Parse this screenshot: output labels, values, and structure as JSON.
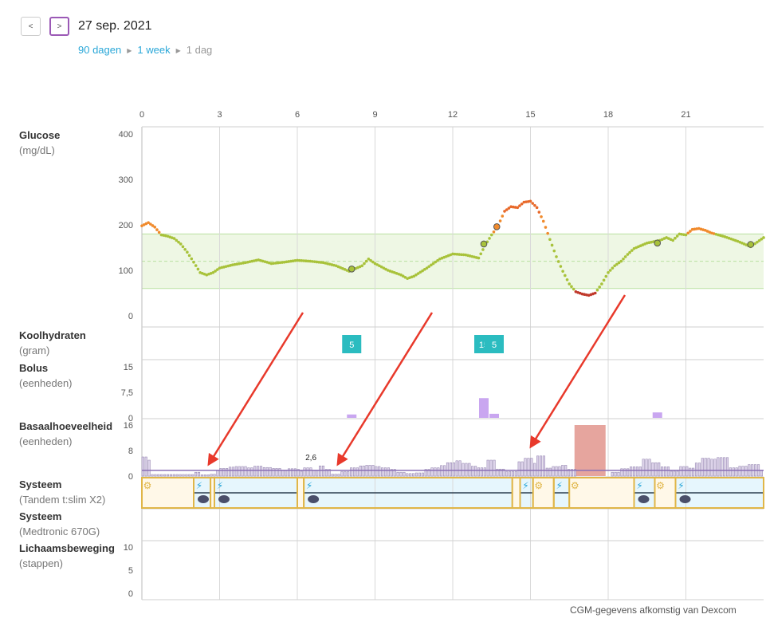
{
  "nav": {
    "prev_label": "<",
    "next_label": ">",
    "date": "27 sep. 2021"
  },
  "period": {
    "d90": "90 dagen",
    "week": "1 week",
    "day": "1 dag"
  },
  "rows": {
    "glucose": {
      "label": "Glucose",
      "unit": "(mg/dL)"
    },
    "carbs": {
      "label": "Koolhydraten",
      "unit": "(gram)"
    },
    "bolus": {
      "label": "Bolus",
      "unit": "(eenheden)"
    },
    "basal": {
      "label": "Basaalhoeveelheid",
      "unit": "(eenheden)"
    },
    "system1": {
      "label": "Systeem",
      "unit": "(Tandem t:slim X2)"
    },
    "system2": {
      "label": "Systeem",
      "unit": "(Medtronic 670G)"
    },
    "activity": {
      "label": "Lichaamsbeweging",
      "unit": "(stappen)"
    }
  },
  "footer": {
    "credit": "CGM-gegevens afkomstig van Dexcom"
  },
  "colors": {
    "in_range": "#a8c23a",
    "high": "#f08a2c",
    "very_high": "#e8692a",
    "low": "#c0392b",
    "target_band": "#eef7e4",
    "bolus": "#c9a6f0",
    "basal": "#ddd3ea",
    "basal_line": "#8a6fb5",
    "carb": "#2bbcc0",
    "temp_basal": "#e6a59e",
    "tandem_band": "#e6f6fd",
    "mode_border": "#e0b648",
    "arrow": "#e8392b"
  },
  "chart_data": {
    "type": "line",
    "x_axis": {
      "label": "",
      "ticks": [
        0,
        3,
        6,
        9,
        12,
        15,
        18,
        21
      ],
      "range_hours": [
        0,
        24
      ]
    },
    "glucose": {
      "y_ticks": [
        0,
        100,
        200,
        300,
        400
      ],
      "ylim": [
        0,
        400
      ],
      "target_range": [
        60,
        180
      ],
      "target_mid": 120,
      "series": [
        [
          0,
          198
        ],
        [
          0.25,
          205
        ],
        [
          0.5,
          195
        ],
        [
          0.75,
          178
        ],
        [
          1,
          175
        ],
        [
          1.25,
          170
        ],
        [
          1.5,
          158
        ],
        [
          1.75,
          140
        ],
        [
          2,
          118
        ],
        [
          2.25,
          95
        ],
        [
          2.5,
          90
        ],
        [
          2.75,
          95
        ],
        [
          3,
          105
        ],
        [
          3.5,
          112
        ],
        [
          4,
          117
        ],
        [
          4.5,
          123
        ],
        [
          5,
          115
        ],
        [
          5.5,
          118
        ],
        [
          6,
          122
        ],
        [
          6.5,
          120
        ],
        [
          7,
          117
        ],
        [
          7.5,
          110
        ],
        [
          8,
          98
        ],
        [
          8.5,
          110
        ],
        [
          8.75,
          125
        ],
        [
          9,
          115
        ],
        [
          9.5,
          100
        ],
        [
          10,
          90
        ],
        [
          10.25,
          82
        ],
        [
          10.5,
          87
        ],
        [
          11,
          105
        ],
        [
          11.5,
          125
        ],
        [
          12,
          136
        ],
        [
          12.5,
          134
        ],
        [
          13,
          127
        ],
        [
          13.25,
          155
        ],
        [
          13.5,
          178
        ],
        [
          13.75,
          198
        ],
        [
          14,
          230
        ],
        [
          14.25,
          240
        ],
        [
          14.5,
          238
        ],
        [
          14.75,
          250
        ],
        [
          15,
          252
        ],
        [
          15.25,
          238
        ],
        [
          15.5,
          208
        ],
        [
          15.75,
          168
        ],
        [
          16,
          130
        ],
        [
          16.25,
          98
        ],
        [
          16.5,
          70
        ],
        [
          16.75,
          53
        ],
        [
          17,
          48
        ],
        [
          17.25,
          45
        ],
        [
          17.5,
          50
        ],
        [
          17.75,
          70
        ],
        [
          18,
          95
        ],
        [
          18.25,
          110
        ],
        [
          18.5,
          120
        ],
        [
          18.75,
          135
        ],
        [
          19,
          148
        ],
        [
          19.5,
          160
        ],
        [
          20,
          166
        ],
        [
          20.25,
          172
        ],
        [
          20.5,
          166
        ],
        [
          20.75,
          180
        ],
        [
          21,
          178
        ],
        [
          21.25,
          190
        ],
        [
          21.5,
          192
        ],
        [
          21.75,
          188
        ],
        [
          22,
          182
        ],
        [
          22.5,
          174
        ],
        [
          23,
          164
        ],
        [
          23.25,
          158
        ],
        [
          23.5,
          152
        ],
        [
          24,
          172
        ]
      ],
      "meter_readings": [
        [
          8.1,
          103
        ],
        [
          13.2,
          158
        ],
        [
          13.7,
          196
        ],
        [
          19.9,
          160
        ],
        [
          23.5,
          157
        ]
      ]
    },
    "carbs": [
      {
        "x": 8.1,
        "label": "5"
      },
      {
        "x": 13.2,
        "label": "15"
      },
      {
        "x": 13.6,
        "label": "5"
      }
    ],
    "bolus": {
      "y_ticks": [
        "0",
        "7,5",
        "15"
      ],
      "ymax": 15,
      "values": [
        [
          8.1,
          1
        ],
        [
          13.2,
          5.8
        ],
        [
          13.6,
          1.2
        ],
        [
          19.9,
          1.6
        ]
      ]
    },
    "basal": {
      "y_ticks": [
        0,
        8,
        16
      ],
      "ymax": 16,
      "scheduled": 1.8,
      "temp_basal": [
        16.7,
        17.9
      ],
      "annotation": {
        "x": 6.25,
        "value": "2,6"
      },
      "values": [
        [
          0,
          6
        ],
        [
          0.15,
          5
        ],
        [
          0.3,
          0.5
        ],
        [
          2,
          1.2
        ],
        [
          2.2,
          0.4
        ],
        [
          2.6,
          0.6
        ],
        [
          2.8,
          1.8
        ],
        [
          3,
          2.4
        ],
        [
          3.3,
          2.8
        ],
        [
          3.6,
          3
        ],
        [
          4,
          2.6
        ],
        [
          4.3,
          3.1
        ],
        [
          4.6,
          2.7
        ],
        [
          5,
          2.4
        ],
        [
          5.3,
          1.9
        ],
        [
          5.6,
          2.3
        ],
        [
          5.9,
          2.1
        ],
        [
          6.1,
          1.5
        ],
        [
          6.2,
          2.6
        ],
        [
          6.5,
          1.8
        ],
        [
          6.8,
          3.2
        ],
        [
          7,
          2.1
        ],
        [
          7.3,
          0.6
        ],
        [
          7.6,
          1.4
        ],
        [
          8,
          2.6
        ],
        [
          8.3,
          3.2
        ],
        [
          8.6,
          3.4
        ],
        [
          8.9,
          3
        ],
        [
          9.2,
          2.6
        ],
        [
          9.5,
          2.1
        ],
        [
          9.8,
          1.2
        ],
        [
          10.1,
          0.8
        ],
        [
          10.5,
          1
        ],
        [
          10.8,
          2.1
        ],
        [
          11.1,
          2.6
        ],
        [
          11.4,
          3.3
        ],
        [
          11.7,
          4.2
        ],
        [
          12,
          4.8
        ],
        [
          12.3,
          4
        ],
        [
          12.6,
          3.1
        ],
        [
          12.9,
          2.6
        ],
        [
          13.2,
          5
        ],
        [
          13.6,
          2.2
        ],
        [
          14,
          1.4
        ],
        [
          14.4,
          4.5
        ],
        [
          14.7,
          5.6
        ],
        [
          15,
          4
        ],
        [
          15.2,
          6.3
        ],
        [
          15.5,
          2.5
        ],
        [
          15.8,
          3
        ],
        [
          16.1,
          3.4
        ],
        [
          16.4,
          2.1
        ],
        [
          16.7,
          0
        ],
        [
          18,
          1.2
        ],
        [
          18.4,
          2.3
        ],
        [
          18.8,
          2.9
        ],
        [
          19.2,
          5.3
        ],
        [
          19.6,
          4.2
        ],
        [
          20,
          2.9
        ],
        [
          20.3,
          1.5
        ],
        [
          20.7,
          3
        ],
        [
          21,
          2.5
        ],
        [
          21.3,
          4.1
        ],
        [
          21.6,
          5.6
        ],
        [
          21.9,
          5.3
        ],
        [
          22.2,
          5.8
        ],
        [
          22.6,
          2.6
        ],
        [
          23,
          3.1
        ],
        [
          23.4,
          3.6
        ],
        [
          23.8,
          1.9
        ]
      ]
    },
    "system_modes": [
      [
        0,
        2
      ],
      [
        2,
        2.65
      ],
      [
        2.65,
        2.8
      ],
      [
        2.8,
        6
      ],
      [
        6,
        6.25
      ],
      [
        6.25,
        14.3
      ],
      [
        14.3,
        14.6
      ],
      [
        14.6,
        15.1
      ],
      [
        15.1,
        15.9
      ],
      [
        15.9,
        16.5
      ],
      [
        16.5,
        19
      ],
      [
        19,
        19.8
      ],
      [
        19.8,
        20.6
      ],
      [
        20.6,
        24
      ]
    ],
    "activity": {
      "y_ticks": [
        0,
        5,
        10
      ],
      "values": []
    }
  }
}
